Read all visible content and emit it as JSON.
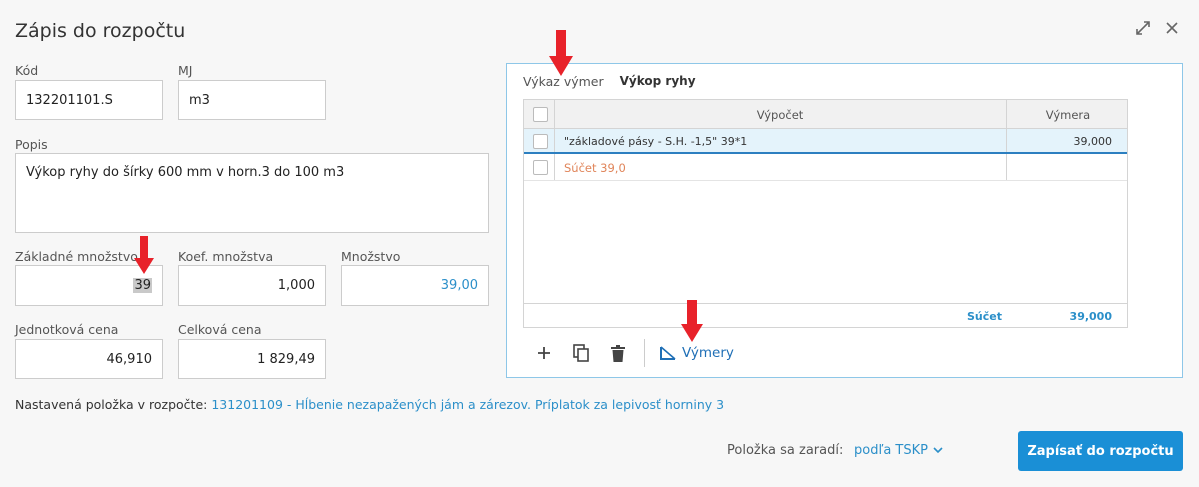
{
  "dialog": {
    "title": "Zápis do rozpočtu"
  },
  "form": {
    "kod": {
      "label": "Kód",
      "value": "132201101.S"
    },
    "mj": {
      "label": "MJ",
      "value": "m3"
    },
    "popis": {
      "label": "Popis",
      "value": "Výkop ryhy do šírky 600 mm v horn.3 do 100 m3"
    },
    "zakladne_mnozstvo": {
      "label": "Základné množstvo",
      "value": "39"
    },
    "koef_mnozstva": {
      "label": "Koef. množstva",
      "value": "1,000"
    },
    "mnozstvo": {
      "label": "Množstvo",
      "value": "39,00"
    },
    "jednotkova_cena": {
      "label": "Jednotková cena",
      "value": "46,910"
    },
    "celkova_cena": {
      "label": "Celková cena",
      "value": "1 829,49"
    }
  },
  "panel": {
    "tabs": [
      "Výkaz výmer",
      "Výkop ryhy"
    ],
    "columns": {
      "vypocet": "Výpočet",
      "vymera": "Výmera"
    },
    "rows": [
      {
        "vypocet": "\"základové pásy - S.H. -1,5\" 39*1",
        "vymera": "39,000"
      },
      {
        "vypocet": "Súčet 39,0",
        "vymera": ""
      }
    ],
    "footer": {
      "label": "Súčet",
      "value": "39,000"
    },
    "toolbar": {
      "vymery_label": "Výmery"
    }
  },
  "info": {
    "prefix": "Nastavená položka v rozpočte:",
    "link": "131201109 - Hĺbenie nezapažených jám a zárezov. Príplatok za lepivosť horniny 3"
  },
  "footer": {
    "zaradi_label": "Položka sa zaradí:",
    "zaradi_value": "podľa TSKP",
    "submit_label": "Zapísať do rozpočtu"
  },
  "colors": {
    "accent": "#1a8fd6",
    "link": "#2b8fc9",
    "sum_orange": "#e0855a",
    "arrow_red": "#e8222a"
  }
}
